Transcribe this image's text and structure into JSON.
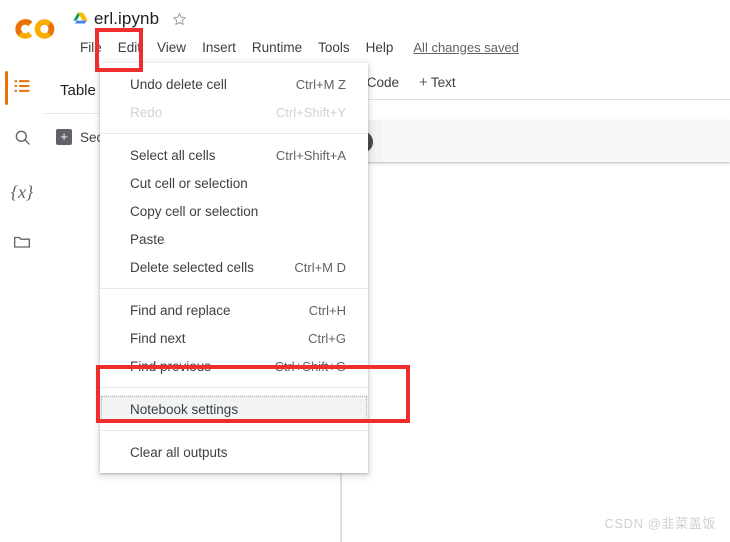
{
  "app": {
    "logo_name": "colab-logo",
    "accent_color": "#e8710a",
    "annotation_color": "#ef2d2d"
  },
  "header": {
    "doc_title": "erl.ipynb",
    "drive_icon": "google-drive-icon",
    "star_icon": "star-outline-icon",
    "saved_status": "All changes saved",
    "menus": [
      {
        "label": "File",
        "open": false
      },
      {
        "label": "Edit",
        "open": true
      },
      {
        "label": "View",
        "open": false
      },
      {
        "label": "Insert",
        "open": false
      },
      {
        "label": "Runtime",
        "open": false
      },
      {
        "label": "Tools",
        "open": false
      },
      {
        "label": "Help",
        "open": false
      }
    ]
  },
  "rail": {
    "items": [
      {
        "name": "table-of-contents-icon",
        "active": true
      },
      {
        "name": "search-icon",
        "active": false
      },
      {
        "name": "variables-icon",
        "label": "{x}",
        "active": false
      },
      {
        "name": "files-folder-icon",
        "active": false
      }
    ]
  },
  "toc": {
    "title": "Table of contents",
    "section_button_label": "+",
    "section_label": "Section"
  },
  "notebook": {
    "toolbar": [
      {
        "label": "Code",
        "icon": "plus-icon"
      },
      {
        "label": "Text",
        "icon": "plus-icon"
      }
    ],
    "cell_run_button": "run-cell-button"
  },
  "edit_menu": {
    "groups": [
      {
        "items": [
          {
            "label": "Undo delete cell",
            "accel": "Ctrl+M Z",
            "disabled": false,
            "highlight": false
          },
          {
            "label": "Redo",
            "accel": "Ctrl+Shift+Y",
            "disabled": true,
            "highlight": false
          }
        ]
      },
      {
        "items": [
          {
            "label": "Select all cells",
            "accel": "Ctrl+Shift+A",
            "disabled": false,
            "highlight": false
          },
          {
            "label": "Cut cell or selection",
            "accel": "",
            "disabled": false,
            "highlight": false
          },
          {
            "label": "Copy cell or selection",
            "accel": "",
            "disabled": false,
            "highlight": false
          },
          {
            "label": "Paste",
            "accel": "",
            "disabled": false,
            "highlight": false
          },
          {
            "label": "Delete selected cells",
            "accel": "Ctrl+M D",
            "disabled": false,
            "highlight": false
          }
        ]
      },
      {
        "items": [
          {
            "label": "Find and replace",
            "accel": "Ctrl+H",
            "disabled": false,
            "highlight": false
          },
          {
            "label": "Find next",
            "accel": "Ctrl+G",
            "disabled": false,
            "highlight": false
          },
          {
            "label": "Find previous",
            "accel": "Ctrl+Shift+G",
            "disabled": false,
            "highlight": false
          }
        ]
      },
      {
        "items": [
          {
            "label": "Notebook settings",
            "accel": "",
            "disabled": false,
            "highlight": true
          }
        ]
      },
      {
        "items": [
          {
            "label": "Clear all outputs",
            "accel": "",
            "disabled": false,
            "highlight": false
          }
        ]
      }
    ]
  },
  "annotations": [
    {
      "name": "annotation-box-edit-menu",
      "target": "Edit"
    },
    {
      "name": "annotation-box-notebook-settings",
      "target": "Notebook settings"
    }
  ],
  "watermark": {
    "text": "CSDN @韭菜盖饭"
  }
}
